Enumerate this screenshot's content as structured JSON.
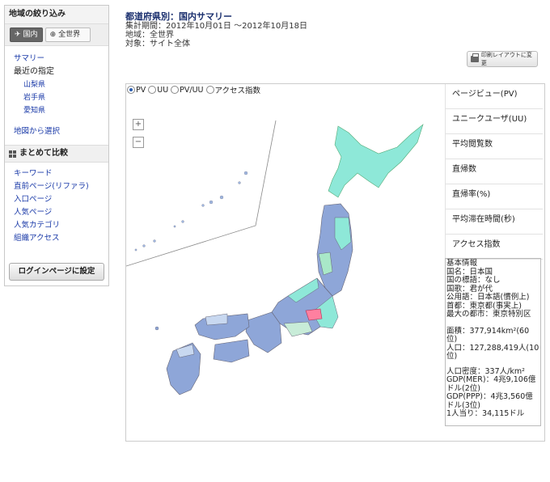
{
  "sidebar": {
    "heading": "地域の絞り込み",
    "tabs": [
      {
        "label": "国内"
      },
      {
        "label": "全世界"
      }
    ],
    "links": {
      "summary": "サマリー",
      "recent": "最近の指定",
      "prefectures": [
        "山梨県",
        "岩手県",
        "愛知県"
      ],
      "map_select": "地図から選択"
    },
    "compare": {
      "heading": "まとめて比較",
      "items": [
        "キーワード",
        "直前ページ(リファラ)",
        "入口ページ",
        "人気ページ",
        "人気カテゴリ",
        "組織アクセス"
      ]
    },
    "login_button": "ログインページに設定"
  },
  "header": {
    "title": "都道府県別：国内サマリー",
    "period": "集計期間：2012年10月01日 ～2012年10月18日",
    "region": "地域：全世界",
    "target": "対象：サイト全体",
    "print_button": "印刷レイアウトに変更"
  },
  "radios": [
    {
      "label": "PV",
      "checked": true
    },
    {
      "label": "UU",
      "checked": false
    },
    {
      "label": "PV/UU",
      "checked": false
    },
    {
      "label": "アクセス指数",
      "checked": false
    }
  ],
  "zoom": {
    "in": "+",
    "out": "−"
  },
  "metrics": [
    "ページビュー(PV)",
    "ユニークユーザ(UU)",
    "平均閲覧数",
    "直帰数",
    "直帰率(%)",
    "平均滞在時間(秒)",
    "アクセス指数"
  ],
  "info": [
    "基本情報",
    "国名：日本国",
    "国の標語：なし",
    "国歌：君が代",
    "公用語：日本語(慣例上)",
    "首都：東京都(事実上)",
    "最大の都市：東京特別区",
    "",
    "面積：377,914km²(60位)",
    "人口：127,288,419人(10位)",
    "",
    "人口密度：337人/km²",
    "GDP(MER)：4兆9,106億ドル(2位)",
    "GDP(PPP)：4兆3,560億ドル(3位)",
    "1人当り：34,115ドル"
  ],
  "colors": {
    "accent": "#1a2f6e",
    "link": "#1a3aa8",
    "map_high": "#8ee8d8",
    "map_mid": "#8ea6d8",
    "map_low": "#c8d8f0",
    "map_highlight": "#ff80a0"
  }
}
